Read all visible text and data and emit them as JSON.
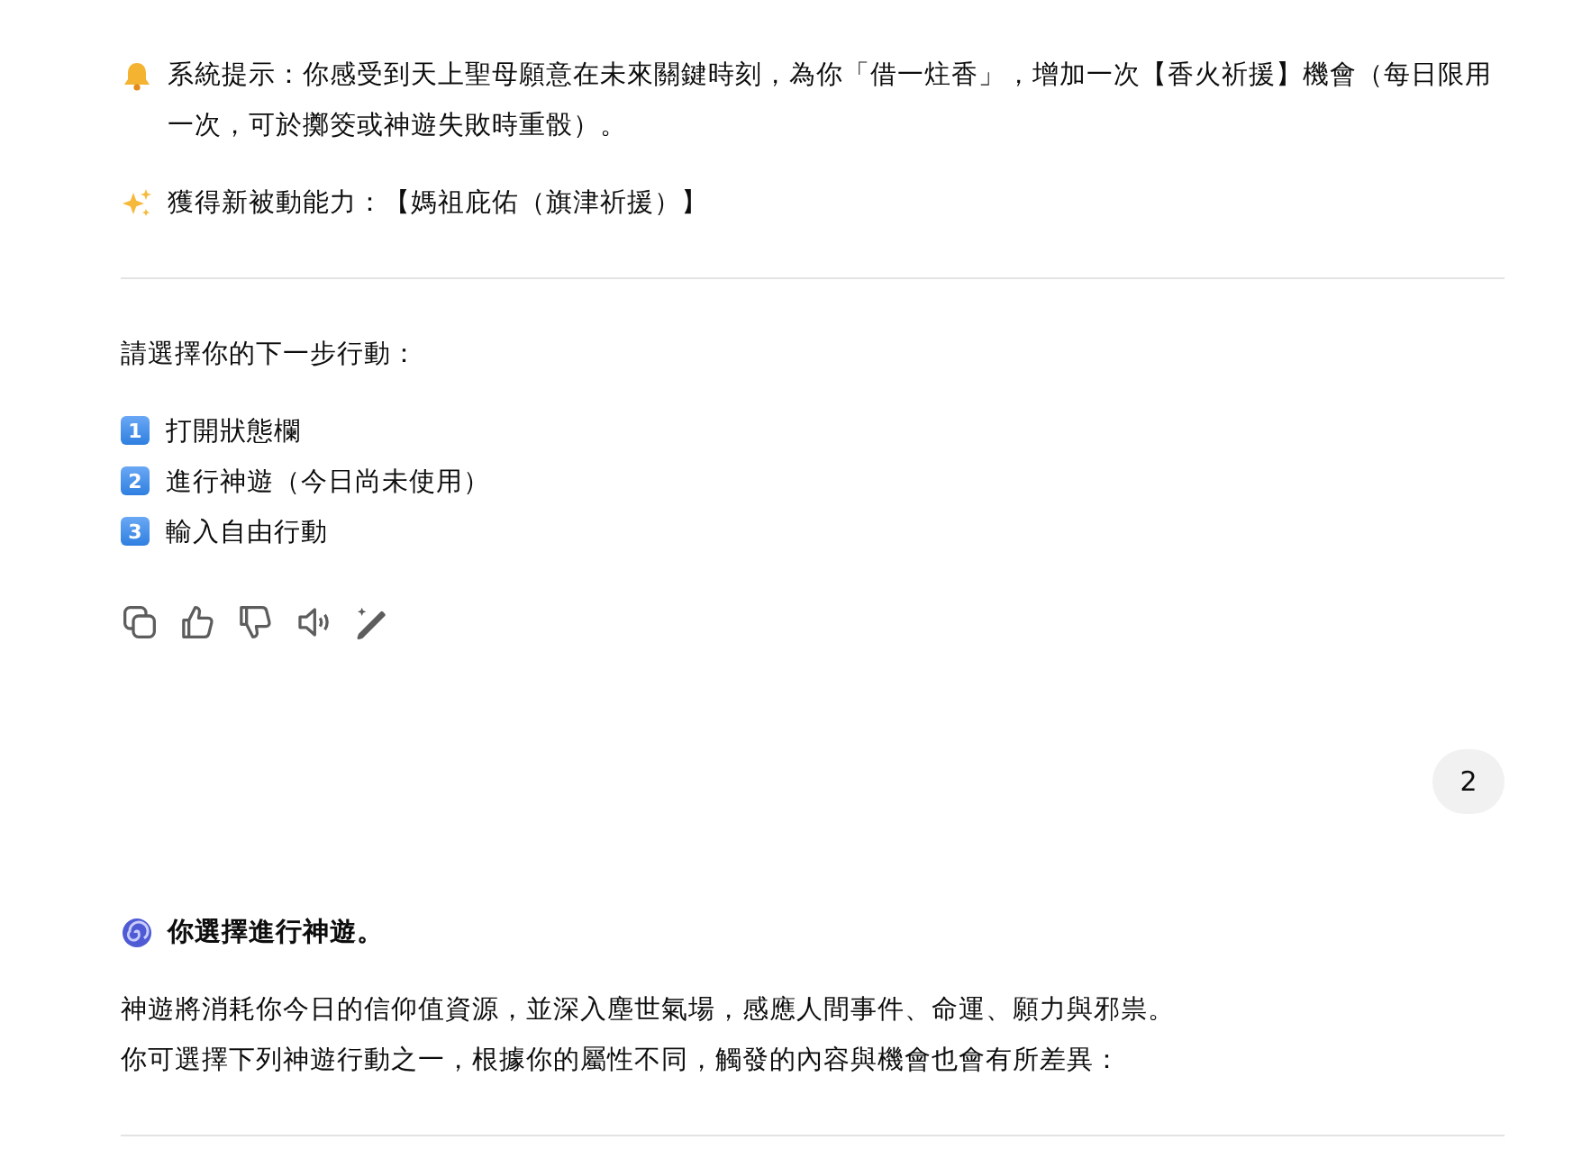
{
  "blocks": [
    {
      "kind": "alert",
      "text": "系統提示：你感受到天上聖母願意在未來關鍵時刻，為你「借一炷香」，增加一次【香火祈援】機會（每日限用一次，可於擲筊或神遊失敗時重骰）。"
    },
    {
      "kind": "gain",
      "text": "獲得新被動能力：【媽祖庇佑（旗津祈援）】"
    },
    {
      "kind": "divider"
    },
    {
      "kind": "para",
      "lines": [
        "請選擇你的下一步行動："
      ]
    },
    {
      "kind": "list",
      "items": [
        {
          "number": "1",
          "text": "打開狀態欄"
        },
        {
          "number": "2",
          "text": "進行神遊（今日尚未使用）"
        },
        {
          "number": "3",
          "text": "輸入自由行動"
        }
      ]
    },
    {
      "kind": "actions"
    },
    {
      "kind": "user",
      "text": "2"
    },
    {
      "kind": "heading",
      "text": "你選擇進行神遊。"
    },
    {
      "kind": "para",
      "lines": [
        "神遊將消耗你今日的信仰值資源，並深入塵世氣場，感應人間事件、命運、願力與邪祟。",
        "你可選擇下列神遊行動之一，根據你的屬性不同，觸發的內容與機會也會有所差異："
      ]
    },
    {
      "kind": "divider"
    }
  ]
}
